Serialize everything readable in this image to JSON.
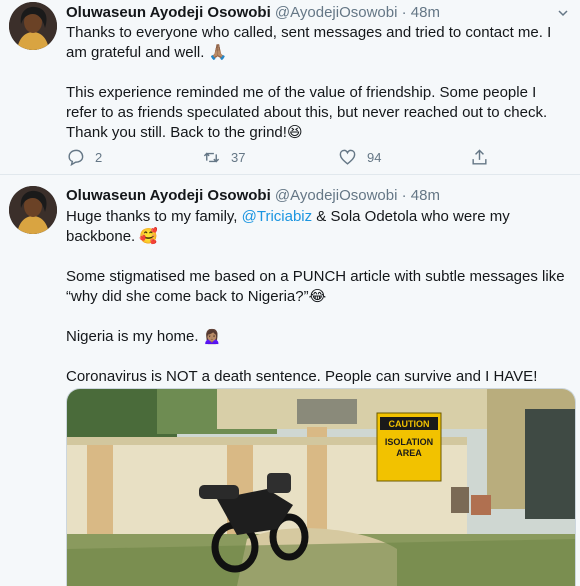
{
  "tweets": [
    {
      "author_name": "Oluwaseun Ayodeji Osowobi",
      "handle": "@AyodejiOsowobi",
      "separator": "·",
      "time": "48m",
      "paragraphs": [
        "Thanks to everyone who called, sent messages and tried to contact me. I am grateful and well. 🙏🏽",
        "This experience reminded me of the value of friendship. Some people I refer to as friends speculated about this, but never reached out to check. Thank you still. Back to the grind!😆"
      ],
      "actions": {
        "reply_count": "2",
        "retweet_count": "37",
        "like_count": "94"
      }
    },
    {
      "author_name": "Oluwaseun Ayodeji Osowobi",
      "handle": "@AyodejiOsowobi",
      "separator": "·",
      "time": "48m",
      "line1_before": "Huge thanks to my family, ",
      "line1_mention": "@Triciabiz",
      "line1_after": " & Sola Odetola who were my backbone. 🥰",
      "para2": "Some stigmatised me based on a PUNCH article with subtle messages like “why did she come back to Nigeria?”😂",
      "para3": "Nigeria is my home. 🙍🏽‍♀️",
      "para4": "Coronavirus is NOT a death sentence. People can survive and I HAVE!",
      "media": {
        "sign_line1": "CAUTION",
        "sign_line2": "ISOLATION",
        "sign_line3": "AREA"
      }
    }
  ],
  "colors": {
    "link": "#1b95e0",
    "muted": "#657786",
    "sign_yellow": "#f2c200"
  },
  "icons": [
    "reply-icon",
    "retweet-icon",
    "like-icon",
    "share-icon",
    "caret-down-icon"
  ]
}
